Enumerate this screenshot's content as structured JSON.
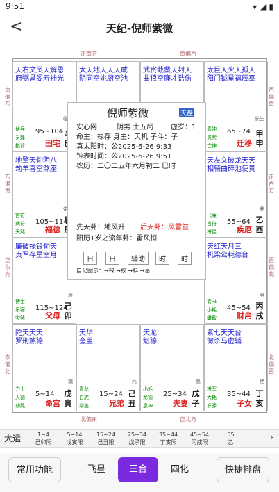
{
  "status": {
    "time": "9:51"
  },
  "nav": {
    "title": "天纪-倪师紫微",
    "back": "<"
  },
  "directions": {
    "top_left": "正南方",
    "top_right": "南偏西",
    "bottom_left": "北偏东",
    "bottom_right": "正北方",
    "left1": "南偏东",
    "left2": "东偏南",
    "left3": "正东方",
    "left4": "东偏北",
    "right1": "西偏南",
    "right2": "正西方",
    "right3": "西偏北",
    "right4": "北偏西"
  },
  "cells": [
    {
      "id": "si",
      "stars": "天右文凤天解恩",
      "stars2": "府弼昌阁寿神光",
      "palace": "田宅",
      "gz1": "辛",
      "gz2": "巳",
      "range": "95~104",
      "b1": "伏兵",
      "b2": "岁建",
      "b3": "指背",
      "mini": "临官"
    },
    {
      "id": "wu",
      "stars": "太天地天天天咸",
      "stars2": "阴同空姚厨空池",
      "palace": "官禄",
      "gz1": "壬",
      "gz2": "午",
      "range": "85~94",
      "b1": "大耗",
      "b2": "晦气",
      "b3": "咸池",
      "mini": "冠带"
    },
    {
      "id": "wei",
      "stars": "武贪截蜚天封天",
      "stars2": "曲狼空廉才诰伤",
      "palace": "交友",
      "gz1": "癸",
      "gz2": "未",
      "range": "75~84",
      "b1": "病符",
      "b2": "丧门",
      "b3": "月煞",
      "mini": "沐浴"
    },
    {
      "id": "shen",
      "stars": "太巨天火天孤天",
      "stars2": "阳门钺星福辰巫",
      "palace": "迁移",
      "gz1": "甲",
      "gz2": "申",
      "range": "65~74",
      "b1": "喜神",
      "b2": "贯索",
      "b3": "亡神",
      "mini": "长生"
    },
    {
      "id": "chen",
      "stars": "地擎天旬阴八",
      "stars2": "劫羊喜空煞座",
      "palace": "福德",
      "gz1": "庚",
      "gz2": "辰",
      "range": "105~114",
      "b1": "官符",
      "b2": "病符",
      "b3": "天煞",
      "mini": "帝旺"
    },
    {
      "id": "you",
      "stars": "天左文破龙天天",
      "stars2": "相辅曲碎池使贵",
      "palace": "疾厄",
      "gz1": "乙",
      "gz2": "酉",
      "range": "55~64",
      "b1": "飞廉",
      "b2": "官符",
      "b3": "将星",
      "mini": "养"
    },
    {
      "id": "mao",
      "stars": "廉破禄铃旬天",
      "stars2": "贞军存星空月",
      "palace": "父母",
      "gz1": "己",
      "gz2": "卯",
      "range": "115~124",
      "b1": "博士",
      "b2": "吊客",
      "b3": "灾煞",
      "mini": "衰"
    },
    {
      "id": "xu",
      "stars": "天红天月三",
      "stars2": "机梁鸾耗德台",
      "palace": "财帛",
      "gz1": "丙",
      "gz2": "戌",
      "range": "45~54",
      "b1": "奏书",
      "b2": "小耗",
      "b3": "攀鞍",
      "mini": "胎"
    },
    {
      "id": "yin",
      "stars": "陀天天天",
      "stars2": "罗刑煞德",
      "palace": "命宫",
      "gz1": "戊",
      "gz2": "寅",
      "range": "5~14",
      "b1": "力士",
      "b2": "天德",
      "b3": "劫煞",
      "mini": "病"
    },
    {
      "id": "chou",
      "stars": "天华",
      "stars2": "奎盖",
      "palace": "兄弟",
      "gz1": "己",
      "gz2": "丑",
      "range": "15~24",
      "b1": "青龙",
      "b2": "白虎",
      "b3": "华盖",
      "mini": "死"
    },
    {
      "id": "zi",
      "stars": "天龙",
      "stars2": "魁德",
      "palace": "夫妻",
      "gz1": "戊",
      "gz2": "子",
      "range": "25~34",
      "b1": "小耗",
      "b2": "龙德",
      "b3": "息神",
      "mini": "墓"
    },
    {
      "id": "hai",
      "stars": "紫七天天台",
      "stars2": "微杀马虚辅",
      "palace": "子女",
      "gz1": "丁",
      "gz2": "亥",
      "range": "35~44",
      "b1": "将军",
      "b2": "大耗",
      "b3": "岁驿",
      "mini": "绝"
    }
  ],
  "center": {
    "name": "倪师紫微",
    "tag": "天盘",
    "line1": "安心网",
    "line1b": "阴男 土五局",
    "line1c": "虚岁：1",
    "line2": "命主：禄存 身主：天机 子斗：子",
    "line3": "真太阳时：公2025-6-26 9:33",
    "line4": "钟表时间：公2025-6-26 9:51",
    "line5": "农历：二〇二五年六月初二 巳时",
    "line6": "先天卦：地风升",
    "line6b": "后天卦：风雷益",
    "line7": "阳历1岁之流年卦：雷风恒",
    "b1": "日",
    "b2": "日",
    "b3": "辅助",
    "b4": "时",
    "b5": "时",
    "legend": "自化图示：→禄 →权 →科 →忌"
  },
  "dayun": {
    "label": "大运",
    "items": [
      [
        "1~4",
        "己卯限"
      ],
      [
        "5~14",
        "戊寅限"
      ],
      [
        "15~24",
        "己丑限"
      ],
      [
        "25~34",
        "戊子限"
      ],
      [
        "35~44",
        "丁亥限"
      ],
      [
        "45~54",
        "丙戌限"
      ],
      [
        "55",
        "乙"
      ]
    ]
  },
  "buttons": {
    "b1": "常用功能",
    "b2": "飞星",
    "b3": "三合",
    "b4": "四化",
    "b5": "快捷排盘"
  },
  "colors": {
    "accent": "#7a2be0",
    "red": "#d22"
  }
}
